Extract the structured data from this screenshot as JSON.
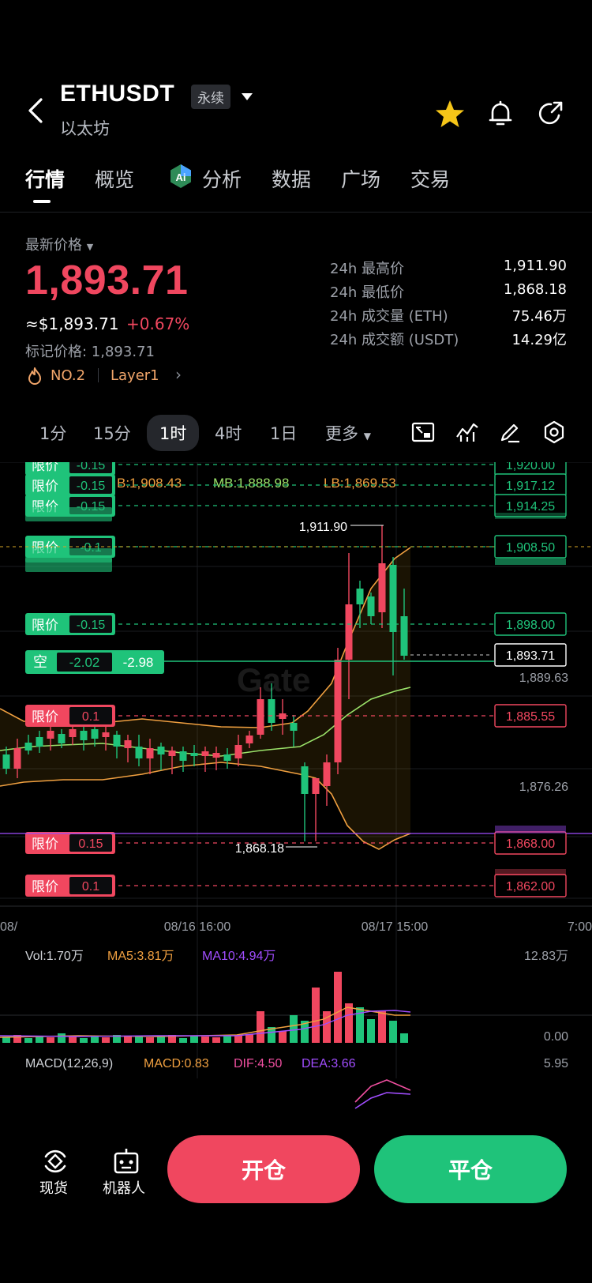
{
  "header": {
    "symbol": "ETHUSDT",
    "contract_badge": "永续",
    "name": "以太坊",
    "icons": [
      "back-icon",
      "star-icon",
      "bell-icon",
      "share-icon"
    ]
  },
  "tabs": [
    {
      "label": "行情",
      "active": true
    },
    {
      "label": "概览"
    },
    {
      "label": "分析",
      "icon": "ai-icon"
    },
    {
      "label": "数据"
    },
    {
      "label": "广场"
    },
    {
      "label": "交易"
    }
  ],
  "price": {
    "latest_label": "最新价格",
    "last": "1,893.71",
    "usd_approx": "≈$1,893.71",
    "change": "+0.67%",
    "mark_label": "标记价格: 1,893.71",
    "rank": "NO.2",
    "sector": "Layer1"
  },
  "stats": [
    {
      "label": "24h 最高价",
      "value": "1,911.90"
    },
    {
      "label": "24h 最低价",
      "value": "1,868.18"
    },
    {
      "label": "24h 成交量 (ETH)",
      "value": "75.46万"
    },
    {
      "label": "24h 成交额 (USDT)",
      "value": "14.29亿"
    }
  ],
  "timeframes": [
    {
      "label": "1分"
    },
    {
      "label": "15分"
    },
    {
      "label": "1时",
      "active": true
    },
    {
      "label": "4时"
    },
    {
      "label": "1日"
    },
    {
      "label": "更多"
    }
  ],
  "tools": [
    "fullscreen-icon",
    "indicator-icon",
    "draw-icon",
    "settings-icon"
  ],
  "chart": {
    "boll": {
      "ub": "B:1,908.43",
      "mb": "MB:1,888.98",
      "lb": "LB:1,869.53"
    },
    "watermark": "Gate",
    "orders_left": [
      {
        "tag": "限价",
        "val": "-0.15",
        "side": "buy"
      },
      {
        "tag": "限价",
        "val": "-0.15",
        "side": "buy"
      },
      {
        "tag": "限价",
        "val": "-0.15",
        "side": "buy"
      },
      {
        "tag": "限价",
        "val": "-0.1",
        "side": "buy"
      },
      {
        "tag": "限价",
        "val": "-0.15",
        "side": "buy"
      },
      {
        "tag": "限价",
        "val": "0.1",
        "side": "sell"
      },
      {
        "tag": "限价",
        "val": "0.15",
        "side": "sell"
      },
      {
        "tag": "限价",
        "val": "0.1",
        "side": "sell"
      }
    ],
    "position": {
      "tag": "空",
      "pnl": "-2.02",
      "size": "-2.98"
    },
    "price_tags": [
      {
        "v": "1,920.00",
        "c": "#1fc37a"
      },
      {
        "v": "1,917.12",
        "c": "#1fc37a"
      },
      {
        "v": "1,914.25",
        "c": "#1fc37a"
      },
      {
        "v": "1,908.50",
        "c": "#1fc37a"
      },
      {
        "v": "1,898.00",
        "c": "#1fc37a"
      },
      {
        "v": "1,893.71",
        "c": "#ffffff"
      },
      {
        "v": "1,885.55",
        "c": "#f0475f"
      },
      {
        "v": "1,868.00",
        "c": "#f0475f"
      },
      {
        "v": "1,862.00",
        "c": "#f0475f"
      }
    ],
    "axis_prices": [
      "1,889.63",
      "1,876.26"
    ],
    "high_label": "1,911.90",
    "low_label": "1,868.18",
    "x_labels": [
      "08/",
      "08/16 16:00",
      "08/17 15:00",
      "7:00"
    ],
    "vol": {
      "vol": "Vol:1.70万",
      "ma5": "MA5:3.81万",
      "ma10": "MA10:4.94万",
      "max": "12.83万",
      "zero": "0.00"
    },
    "macd": {
      "name": "MACD(12,26,9)",
      "macd": "MACD:0.83",
      "dif": "DIF:4.50",
      "dea": "DEA:3.66",
      "max": "5.95"
    },
    "colors": {
      "up": "#1fc37a",
      "down": "#f0475f",
      "ma": "#f0a040",
      "mb": "#9be36a",
      "purple": "#a14dff"
    }
  },
  "bottom": {
    "spot": "现货",
    "bot": "机器人",
    "open": "开仓",
    "close": "平仓"
  }
}
